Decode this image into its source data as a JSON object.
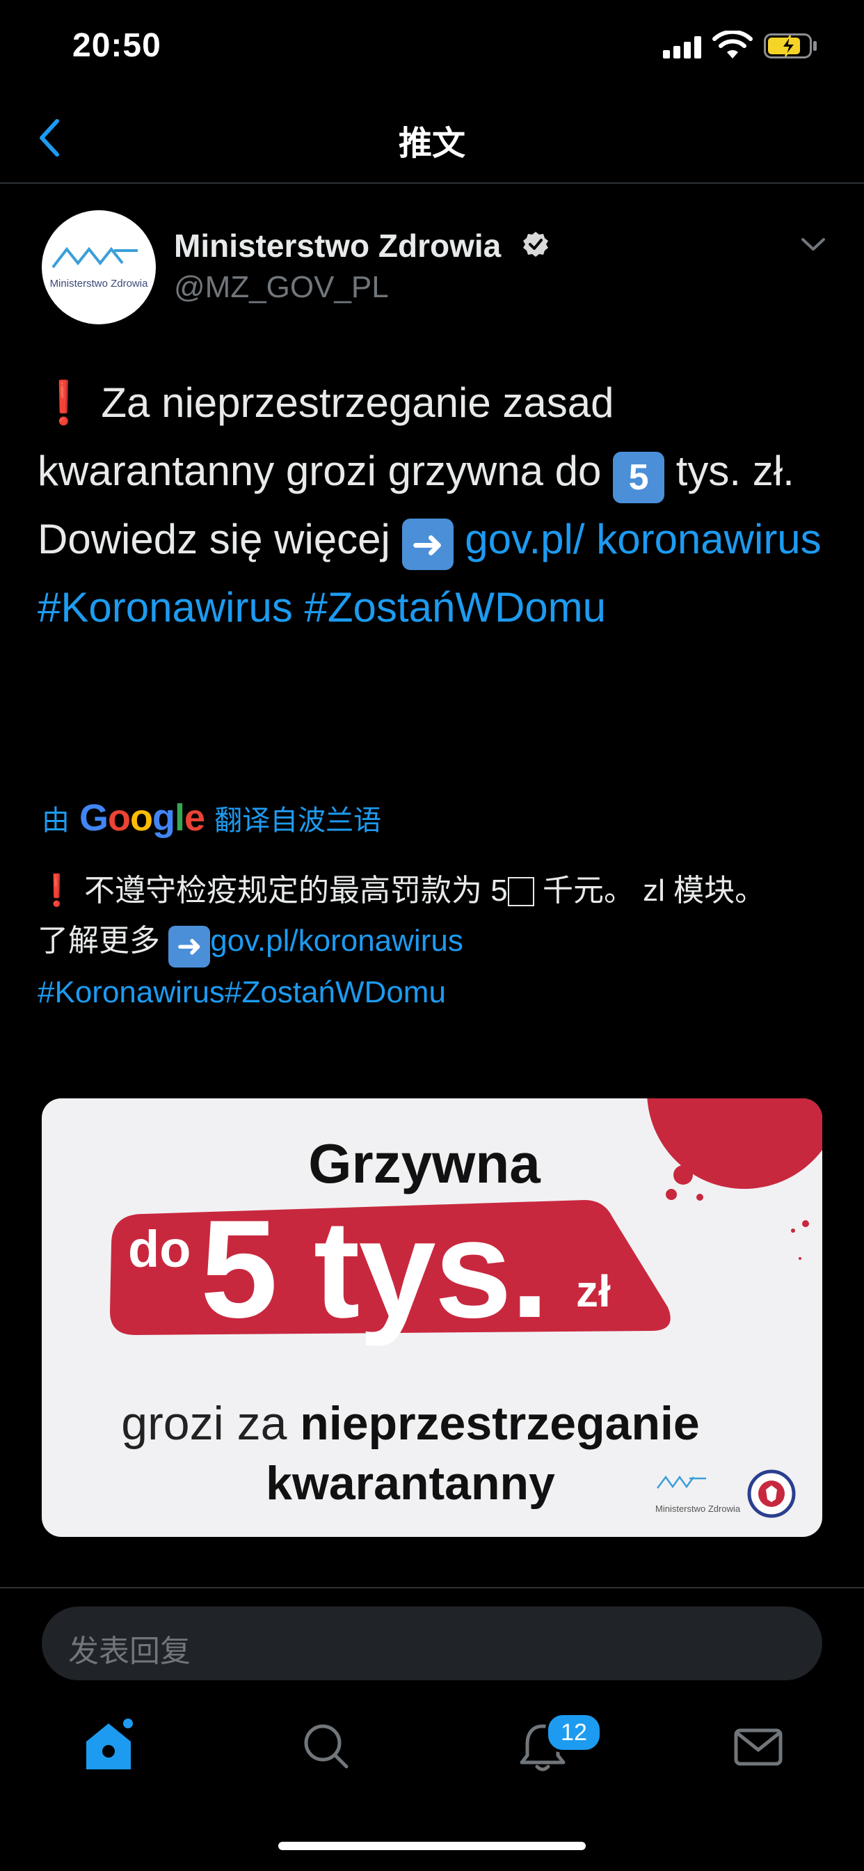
{
  "status_bar": {
    "time": "20:50"
  },
  "nav": {
    "title": "推文"
  },
  "author": {
    "name": "Ministerstwo Zdrowia",
    "handle": "@MZ_GOV_PL",
    "avatar_logo_text": "Ministerstwo Zdrowia"
  },
  "tweet": {
    "line1_emoji": "❗",
    "line1_text": " Za nieprzestrzeganie zasad kwarantanny grozi grzywna do ",
    "keycap": "5",
    "line1_tail": " tys. zł.",
    "line2_text": "Dowiedz się więcej ",
    "link": "gov.pl/ koronawirus",
    "hashtags": "#Koronawirus #ZostańWDomu"
  },
  "translation": {
    "prefix": "由",
    "brand": "Google",
    "suffix": "翻译自波兰语",
    "line1_emoji": "❗",
    "line1_text": " 不遵守检疫规定的最高罚款为 5",
    "line1_tail": " 千元。 zl 模块。",
    "line2_text": "了解更多 ",
    "link": "gov.pl/koronawirus",
    "hashtags": "#Koronawirus#ZostańWDomu"
  },
  "media": {
    "title": "Grzywna",
    "amount_prefix": "do",
    "amount": "5 tys.",
    "amount_unit": "zł",
    "subtitle_plain": "grozi za ",
    "subtitle_bold": "nieprzestrzeganie kwarantanny",
    "logo_text": "Ministerstwo Zdrowia"
  },
  "reply": {
    "placeholder": "发表回复"
  },
  "tab_bar": {
    "notifications_badge": "12"
  },
  "colors": {
    "link": "#1d9bf0",
    "background": "#000000",
    "banner_red": "#c8283e"
  },
  "icons": [
    "back-icon",
    "verified-icon",
    "chevron-down-icon",
    "home-icon",
    "search-icon",
    "bell-icon",
    "mail-icon"
  ]
}
